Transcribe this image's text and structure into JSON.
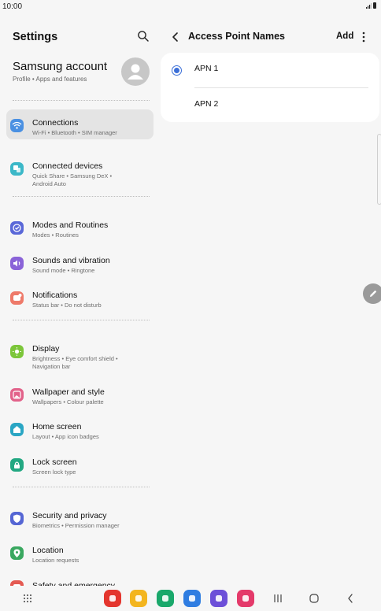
{
  "status_bar": {
    "time": "10:00"
  },
  "settings": {
    "title": "Settings",
    "account": {
      "name": "Samsung account",
      "subtitle": "Profile  •  Apps and features"
    },
    "items": [
      {
        "key": "connections",
        "title": "Connections",
        "subtitle": "Wi-Fi  •  Bluetooth  •  SIM manager",
        "color": "#4a90e2",
        "icon": "wifi-icon",
        "active": true
      },
      {
        "key": "connected-devices",
        "title": "Connected devices",
        "subtitle": "Quick Share  •  Samsung DeX  •\nAndroid Auto",
        "color": "#3cb8c8",
        "icon": "connected-devices-icon"
      },
      {
        "key": "modes-routines",
        "title": "Modes and Routines",
        "subtitle": "Modes  •  Routines",
        "color": "#5a68d8",
        "icon": "check-circle-icon"
      },
      {
        "key": "sounds",
        "title": "Sounds and vibration",
        "subtitle": "Sound mode  •  Ringtone",
        "color": "#8a63d8",
        "icon": "speaker-icon"
      },
      {
        "key": "notifications",
        "title": "Notifications",
        "subtitle": "Status bar  •  Do not disturb",
        "color": "#ee7a6a",
        "icon": "notification-icon"
      },
      {
        "key": "display",
        "title": "Display",
        "subtitle": "Brightness  •  Eye comfort shield  •\nNavigation bar",
        "color": "#7cc63a",
        "icon": "sun-icon"
      },
      {
        "key": "wallpaper",
        "title": "Wallpaper and style",
        "subtitle": "Wallpapers  •  Colour palette",
        "color": "#e2628a",
        "icon": "wallpaper-icon"
      },
      {
        "key": "home-screen",
        "title": "Home screen",
        "subtitle": "Layout  •  App icon badges",
        "color": "#2aa6c4",
        "icon": "home-icon"
      },
      {
        "key": "lock-screen",
        "title": "Lock screen",
        "subtitle": "Screen lock type",
        "color": "#23a882",
        "icon": "lock-icon"
      },
      {
        "key": "security",
        "title": "Security and privacy",
        "subtitle": "Biometrics  •  Permission manager",
        "color": "#5566d4",
        "icon": "shield-icon"
      },
      {
        "key": "location",
        "title": "Location",
        "subtitle": "Location requests",
        "color": "#3aa860",
        "icon": "location-pin-icon"
      },
      {
        "key": "safety",
        "title": "Safety and emergency",
        "subtitle": "",
        "color": "#e45a52",
        "icon": "safety-icon"
      }
    ]
  },
  "apn": {
    "title": "Access Point Names",
    "add_label": "Add",
    "entries": [
      {
        "name": "APN 1",
        "selected": true
      },
      {
        "name": "APN 2",
        "selected": false
      }
    ]
  },
  "taskbar": {
    "apps": [
      {
        "name": "flipboard-app-icon",
        "color": "#e4362e"
      },
      {
        "name": "my-files-app-icon",
        "color": "#f3b51f"
      },
      {
        "name": "phone-app-icon",
        "color": "#1aa86b"
      },
      {
        "name": "messages-app-icon",
        "color": "#2f7de1"
      },
      {
        "name": "internet-app-icon",
        "color": "#6c4fd8"
      },
      {
        "name": "screen-recorder-app-icon",
        "color": "#e43a6a"
      }
    ]
  }
}
